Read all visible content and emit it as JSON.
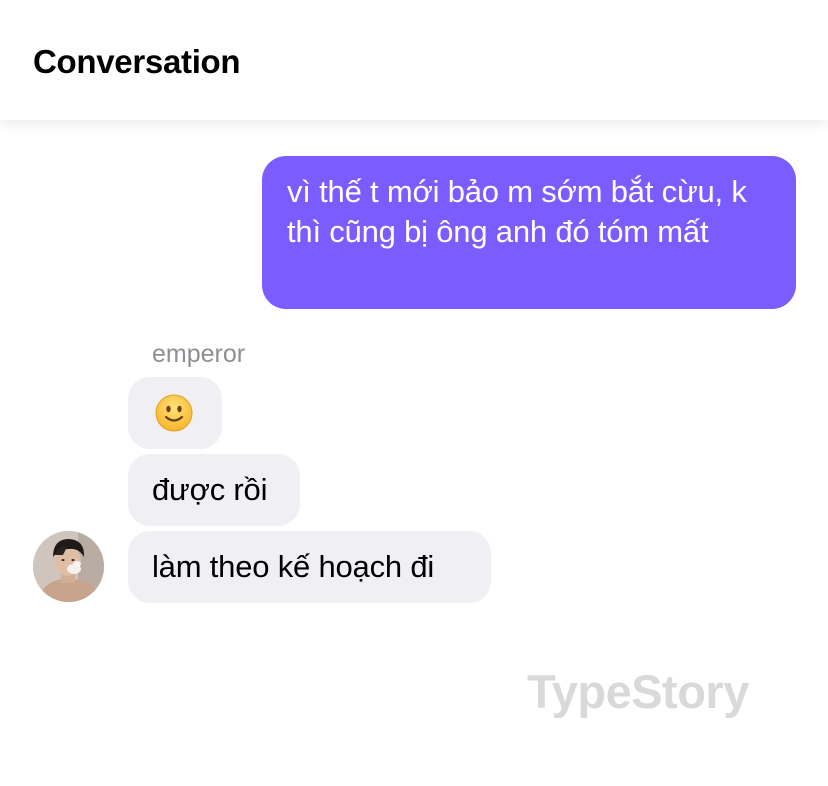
{
  "header": {
    "title": "Conversation"
  },
  "messages": {
    "outgoing": {
      "text": "vì thế t mới bảo m sớm bắt cừu, k thì cũng bị ông anh đó tóm mất"
    },
    "incoming": {
      "sender": "emperor",
      "items": [
        {
          "type": "emoji",
          "emoji": "slightly-smiling-face"
        },
        {
          "type": "text",
          "text": "được rồi"
        },
        {
          "type": "text",
          "text": "làm theo kế hoạch đi"
        }
      ]
    }
  },
  "watermark": "TypeStory",
  "colors": {
    "outgoing_bubble": "#7b5cff",
    "incoming_bubble": "#f0f0f4",
    "sender_name": "#8e8e93",
    "watermark": "#d9d9d9"
  }
}
